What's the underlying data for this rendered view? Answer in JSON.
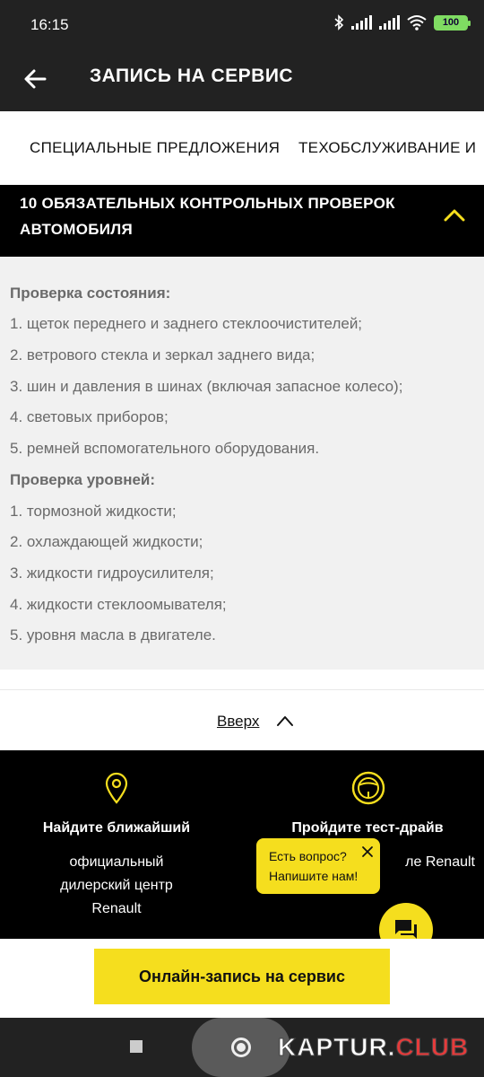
{
  "status": {
    "time": "16:15",
    "battery": "100"
  },
  "header": {
    "title": "ЗАПИСЬ НА СЕРВИС"
  },
  "tabs": [
    {
      "label": "СПЕЦИАЛЬНЫЕ ПРЕДЛОЖЕНИЯ"
    },
    {
      "label": "ТЕХОБСЛУЖИВАНИЕ И"
    }
  ],
  "accordion": {
    "title_line1": "10 ОБЯЗАТЕЛЬНЫХ КОНТРОЛЬНЫХ ПРОВЕРОК",
    "title_line2": "АВТОМОБИЛЯ",
    "lines": [
      "Проверка состояния:",
      "1. щеток переднего и заднего стеклоочистителей;",
      "2. ветрового стекла и зеркал заднего вида;",
      "3. шин и давления в шинах (включая запасное колесо);",
      "4. световых приборов;",
      "5. ремней вспомогательного оборудования.",
      "Проверка уровней:",
      "1. тормозной жидкости;",
      "2. охлаждающей жидкости;",
      "3. жидкости гидроусилителя;",
      "4. жидкости стеклоомывателя;",
      "5. уровня масла в двигателе."
    ]
  },
  "up_link": "Вверх",
  "info": [
    {
      "heading": "Найдите ближайший",
      "text_lines": [
        "официальный",
        "дилерский центр",
        "Renault"
      ]
    },
    {
      "heading": "Пройдите тест-драйв",
      "text_lines": [
        "ле Renault"
      ]
    }
  ],
  "chat": {
    "line1": "Есть вопрос?",
    "line2": "Напишите нам!"
  },
  "cta": {
    "label": "Онлайн-запись на сервис"
  },
  "watermark": {
    "part1": "KAPTUR.",
    "part2": "CLUB"
  },
  "colors": {
    "accent": "#f5de1e",
    "dark": "#000000",
    "panel": "#f1f1f1"
  }
}
